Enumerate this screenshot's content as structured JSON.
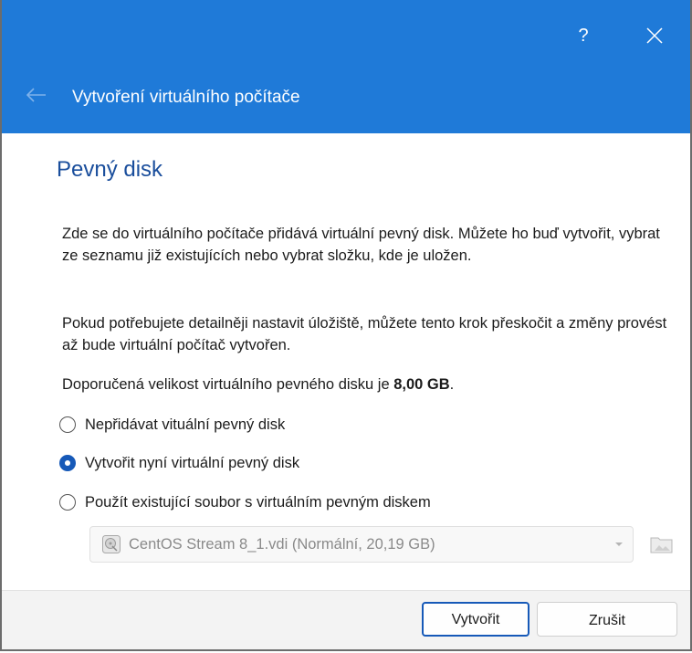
{
  "window": {
    "help_label": "?",
    "title": "Vytvoření virtuálního počítače"
  },
  "page": {
    "title": "Pevný disk",
    "para1": "Zde se do virtuálního počítače přidává virtuální pevný disk. Můžete ho buď vytvořit, vybrat ze seznamu již existujících nebo vybrat složku, kde je uložen.",
    "para2": "Pokud potřebujete detailněji nastavit úložiště, můžete tento krok přeskočit a změny provést až bude virtuální počítač vytvořen.",
    "recommended_prefix": "Doporučená velikost virtuálního pevného disku je ",
    "recommended_size": "8,00 GB",
    "recommended_suffix": "."
  },
  "options": [
    {
      "label": "Nepřidávat vituální pevný disk",
      "checked": false
    },
    {
      "label": "Vytvořit nyní virtuální pevný disk",
      "checked": true
    },
    {
      "label": "Použít existující soubor s virtuálním pevným diskem",
      "checked": false
    }
  ],
  "existing_disk": {
    "selected": "CentOS Stream 8_1.vdi (Normální, 20,19 GB)",
    "disabled": true
  },
  "buttons": {
    "create": "Vytvořit",
    "cancel": "Zrušit"
  },
  "colors": {
    "titlebar": "#1f7ad8",
    "accent": "#1659b8",
    "page_title": "#1a4e9c"
  },
  "icons": {
    "help": "help-icon",
    "close": "close-icon",
    "back": "back-arrow-icon",
    "disk": "hard-disk-icon",
    "dropdown": "chevron-down-icon",
    "folder": "folder-icon"
  }
}
